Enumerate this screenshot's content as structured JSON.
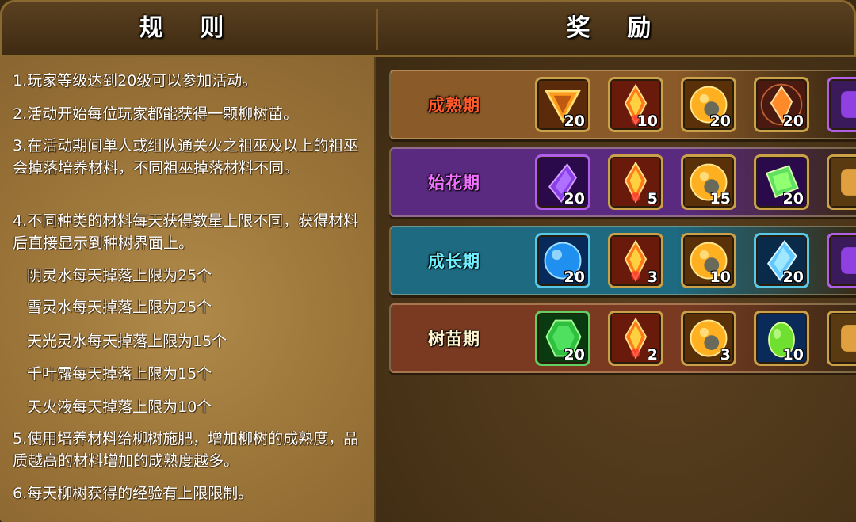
{
  "header": {
    "rules_title": "规 则",
    "rewards_title": "奖 励"
  },
  "rules": [
    "1.玩家等级达到20级可以参加活动。",
    "2.活动开始每位玩家都能获得一颗柳树苗。",
    "3.在活动期间单人或组队通关火之祖巫及以上的祖巫会掉落培养材料，不同祖巫掉落材料不同。",
    "4.不同种类的材料每天获得数量上限不同，获得材料后直接显示到种树界面上。",
    "阴灵水每天掉落上限为25个",
    "雪灵水每天掉落上限为25个",
    "天光灵水每天掉落上限为15个",
    "千叶露每天掉落上限为15个",
    "天火液每天掉落上限为10个",
    "5.使用培养材料给柳树施肥，增加柳树的成熟度，品质越高的材料增加的成熟度越多。",
    "6.每天柳树获得的经验有上限限制。"
  ],
  "tiers": [
    {
      "label": "成熟期",
      "label_color": "#ff5a2a",
      "bg": "#8a5a28",
      "items": [
        {
          "icon": "orange-triangle-gem-icon",
          "qty": "20"
        },
        {
          "icon": "fire-crystal-icon",
          "qty": "10"
        },
        {
          "icon": "golden-orb-icon",
          "qty": "20"
        },
        {
          "icon": "orange-crystal-magic-circle-icon",
          "qty": "20"
        },
        {
          "icon": "purple-item-icon",
          "qty": ""
        }
      ]
    },
    {
      "label": "始花期",
      "label_color": "#f070ff",
      "bg": "#5a2a80",
      "items": [
        {
          "icon": "purple-crystal-icon",
          "qty": "20"
        },
        {
          "icon": "fire-crystal-icon",
          "qty": "5"
        },
        {
          "icon": "golden-orb-icon",
          "qty": "15"
        },
        {
          "icon": "green-cube-gem-icon",
          "qty": "20"
        },
        {
          "icon": "gold-item-icon",
          "qty": ""
        }
      ]
    },
    {
      "label": "成长期",
      "label_color": "#70f0ff",
      "bg": "#1e6a80",
      "items": [
        {
          "icon": "blue-orb-icon",
          "qty": "20"
        },
        {
          "icon": "fire-crystal-icon",
          "qty": "3"
        },
        {
          "icon": "golden-orb-icon",
          "qty": "10"
        },
        {
          "icon": "blue-crystal-icon",
          "qty": "20"
        },
        {
          "icon": "purple-item-icon",
          "qty": ""
        }
      ]
    },
    {
      "label": "树苗期",
      "label_color": "#fff4d0",
      "bg": "#7a3a22",
      "items": [
        {
          "icon": "green-gem-icon",
          "qty": "20"
        },
        {
          "icon": "fire-crystal-icon",
          "qty": "2"
        },
        {
          "icon": "golden-orb-icon",
          "qty": "3"
        },
        {
          "icon": "green-egg-icon",
          "qty": "10"
        },
        {
          "icon": "gold-item-icon",
          "qty": ""
        }
      ]
    }
  ]
}
